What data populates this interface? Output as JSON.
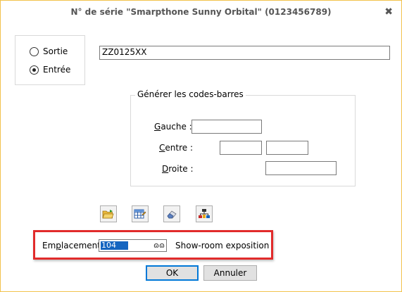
{
  "window": {
    "title": "N° de série \"Smarpthone Sunny Orbital\" (0123456789)",
    "close_glyph": "✖"
  },
  "direction": {
    "options": [
      {
        "label": "Sortie",
        "checked": false
      },
      {
        "label": "Entrée",
        "checked": true
      }
    ]
  },
  "serial": {
    "value": "ZZ0125XX"
  },
  "barcodes": {
    "legend": "Générer les codes-barres",
    "gauche_label": "Gauche :",
    "centre_label": "Centre :",
    "droite_label": "Droite :",
    "gauche_value": "",
    "centre_value_1": "",
    "centre_value_2": "",
    "droite_value": ""
  },
  "toolbar": {
    "icons": [
      "open-folder-icon",
      "table-edit-icon",
      "eraser-icon",
      "network-icon"
    ]
  },
  "emplacement": {
    "label": "Emplacement :",
    "value": "104",
    "lookup_glyph": "ɷɷ",
    "description": "Show-room exposition",
    "highlight_color": "#e12b2b"
  },
  "buttons": {
    "ok": "OK",
    "cancel": "Annuler"
  }
}
